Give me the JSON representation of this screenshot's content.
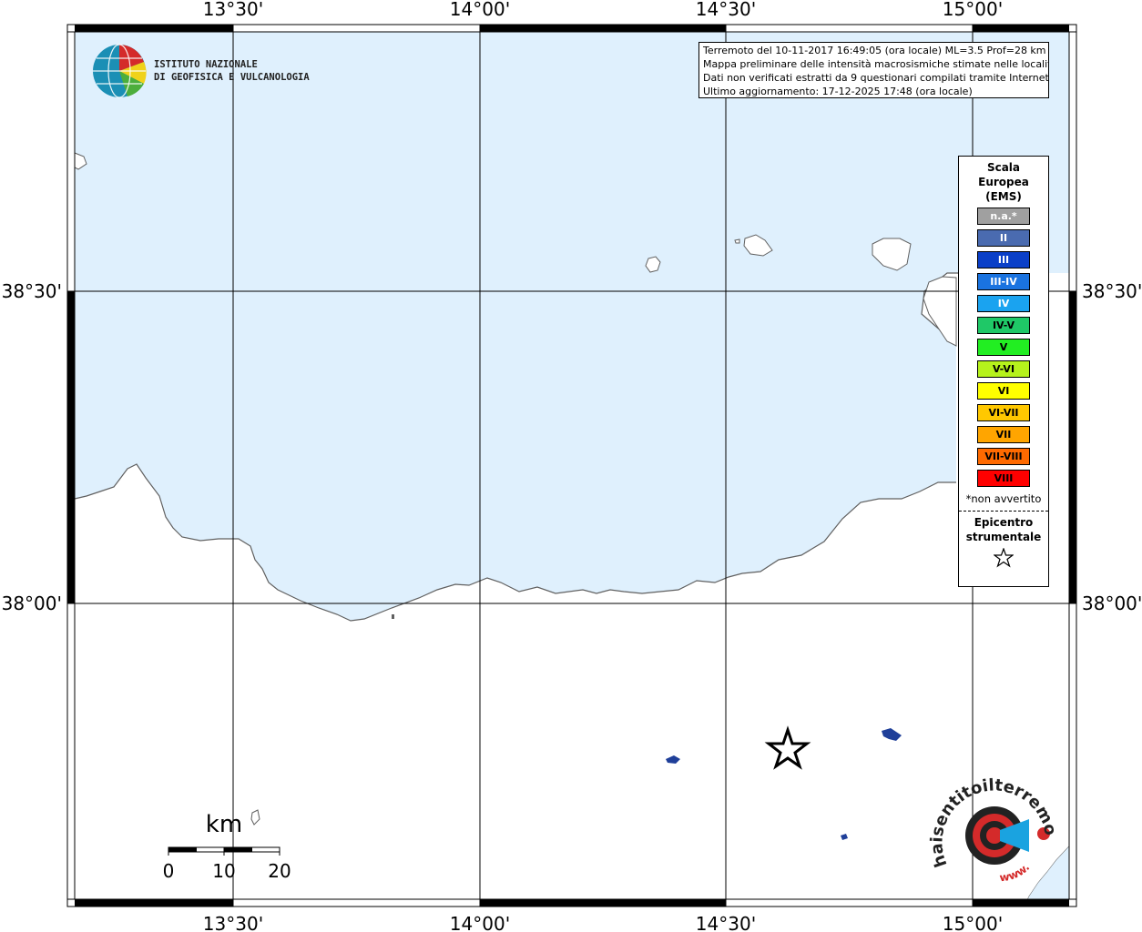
{
  "map": {
    "longitude_labels": [
      "13°30'",
      "14°00'",
      "14°30'",
      "15°00'"
    ],
    "latitude_labels": [
      "38°30'",
      "38°00'"
    ],
    "colors": {
      "sea": "#dff0fd",
      "land": "#ffffff",
      "coast": "#606060",
      "grid": "#000000",
      "lake": "#1f3f99"
    }
  },
  "logo_ingv": {
    "line1": "ISTITUTO NAZIONALE",
    "line2": "DI GEOFISICA E VULCANOLOGIA"
  },
  "info": {
    "line1": "Terremoto del 10-11-2017 16:49:05 (ora locale) ML=3.5 Prof=28 km",
    "line2": "Mappa preliminare delle intensità macrosismiche stimate nelle località",
    "line3": "Dati non verificati estratti da 9 questionari compilati tramite Internet.",
    "line4": "Ultimo aggiornamento: 17-12-2025 17:48 (ora locale)"
  },
  "legend": {
    "title1": "Scala",
    "title2": "Europea",
    "title3": "(EMS)",
    "items": [
      {
        "label": "n.a.*",
        "color": "#a0a0a0",
        "text_color": "#ffffff"
      },
      {
        "label": "II",
        "color": "#4a6bb0",
        "text_color": "#ffffff"
      },
      {
        "label": "III",
        "color": "#0a3fc8",
        "text_color": "#ffffff"
      },
      {
        "label": "III-IV",
        "color": "#1a73e0",
        "text_color": "#ffffff"
      },
      {
        "label": "IV",
        "color": "#1aa3f0",
        "text_color": "#ffffff"
      },
      {
        "label": "IV-V",
        "color": "#1fc867",
        "text_color": "#000000"
      },
      {
        "label": "V",
        "color": "#22ee22",
        "text_color": "#000000"
      },
      {
        "label": "V-VI",
        "color": "#b6f21c",
        "text_color": "#000000"
      },
      {
        "label": "VI",
        "color": "#ffff00",
        "text_color": "#000000"
      },
      {
        "label": "VI-VII",
        "color": "#ffc800",
        "text_color": "#000000"
      },
      {
        "label": "VII",
        "color": "#ffa500",
        "text_color": "#000000"
      },
      {
        "label": "VII-VIII",
        "color": "#ff6a00",
        "text_color": "#000000"
      },
      {
        "label": "VIII",
        "color": "#ff0000",
        "text_color": "#000000"
      }
    ],
    "note": "*non avvertito",
    "epicenter1": "Epicentro",
    "epicenter2": "strumentale"
  },
  "scale_bar": {
    "unit": "km",
    "labels": [
      "0",
      "10",
      "20"
    ]
  },
  "logo_hst": {
    "text": "haisentitoilterremoto.it",
    "www": "www."
  }
}
